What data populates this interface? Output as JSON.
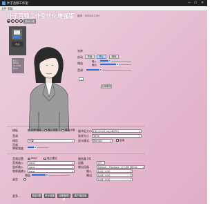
{
  "window": {
    "title": "叶子音频工作室",
    "minimize_glyph": "—",
    "maximize_glyph": "☐",
    "close_glyph": "✕"
  },
  "menu": {
    "items": [
      "文件",
      "帮助"
    ]
  },
  "header": {
    "title": "叶子音频工作室优化增强版",
    "version": "版本：V2024.0 ZH",
    "vip_button": "高级功能",
    "icons": [
      "github-icon",
      "help-icon",
      "info-icon",
      "settings-icon"
    ]
  },
  "thumbnail": {
    "label": "叶子"
  },
  "avatar_info": {
    "lines": [
      "叶子 1",
      "Ready",
      "44.1 kHz",
      "Mono"
    ]
  },
  "controls": {
    "name_label": "名称",
    "mode_label": "启动",
    "mode_buttons": [
      "开始",
      "停止",
      "清除"
    ],
    "input_label": "输入",
    "output_label": "输出",
    "volume_label": "增益",
    "noise_label": "音调",
    "input_value": 0.32,
    "output_value": 0.55,
    "gain_value": 0.6,
    "pitch_value": 0.32,
    "small_select": "",
    "apply_button": "应用更改"
  },
  "mid": {
    "section_label": "模板",
    "radio_options": [
      "同声传译",
      "输入设备",
      "输出设备"
    ],
    "model_label": "模型",
    "model_value": "无模",
    "pitch_label": "音调",
    "index_label": "音频",
    "rate_label": "降噪强度",
    "rate_value": 0.35,
    "chunk_label": "缓冲区大小",
    "chunk_value": "F32 (2/1/2 ms 48076)",
    "sample_label": "采样大小",
    "sample_value": "4096",
    "format_label": "显卡模式",
    "format_value": "Remain",
    "check_label": "启用"
  },
  "audio": {
    "section_label": "音频设置",
    "options": [
      "MME",
      "独占模式"
    ],
    "input_label": "音频输入",
    "input_value": "none",
    "monitor_label": "监听输入",
    "monitor_value": "none",
    "fx_label": "效果器输入",
    "fx_value": "none",
    "gain_label": "增益",
    "gain_value": 0.4,
    "record_label": "录音",
    "server_label": "服务器 I/O",
    "server_device_label": "设备",
    "server_device_value": "I/O",
    "output_label": "输出设备",
    "output_value": "Default - Playback 1 (2-3M MEGA)",
    "output_level_label": "输入",
    "output_level_value": "0:00 / 0:00",
    "output_level2_label": "输出",
    "output_level2_value": "0:00 / 0:00",
    "output_level3_value": "0:00 / 0:00"
  },
  "footer": {
    "more_label": "更多...",
    "buttons": [
      "修复问题",
      "声卡设置",
      "设备管理器",
      "客户端连接"
    ]
  },
  "colors": {
    "accent": "#1f6fd6",
    "title_text": "#ffffff"
  }
}
